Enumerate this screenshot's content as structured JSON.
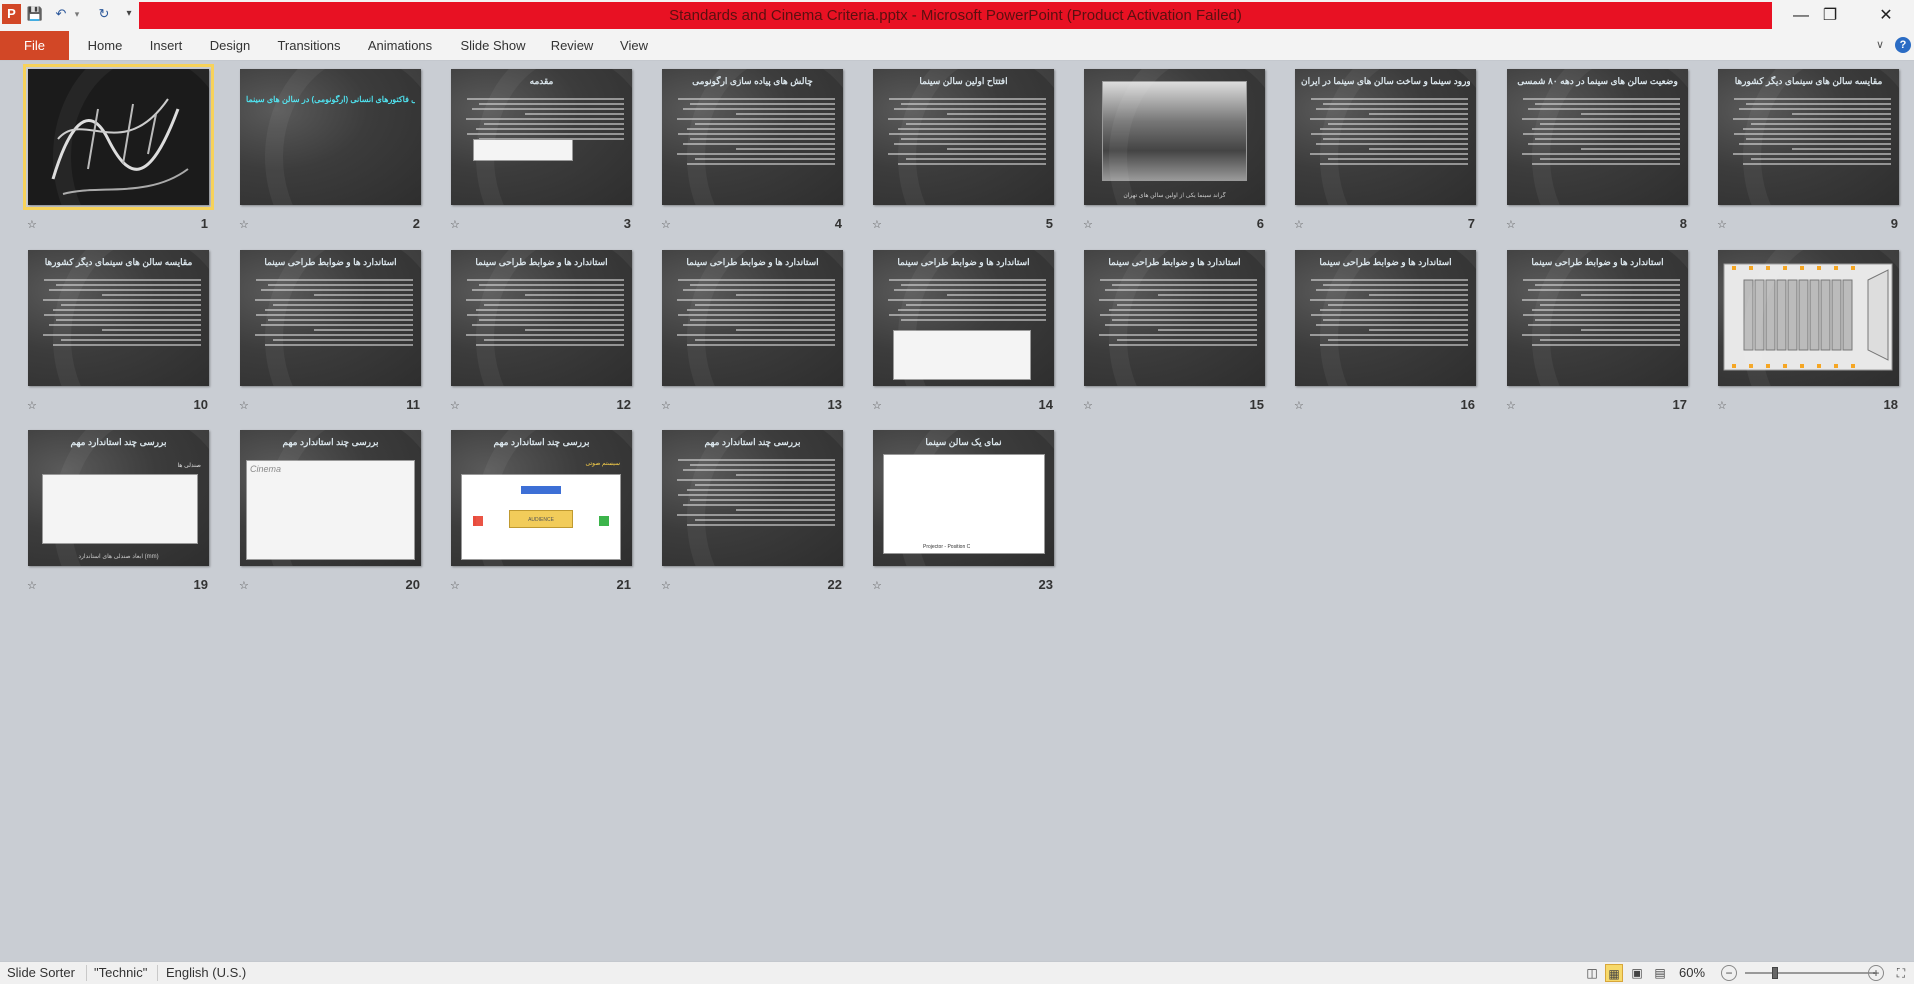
{
  "window": {
    "title": "Standards and Cinema Criteria.pptx  -  Microsoft PowerPoint (Product Activation Failed)",
    "app_icon_letter": "P",
    "quick_access": [
      "save-icon",
      "undo-icon",
      "redo-icon",
      "customize-icon"
    ],
    "controls": {
      "minimize": "—",
      "maximize": "❐",
      "close": "✕"
    }
  },
  "ribbon": {
    "file_tab": "File",
    "tabs": [
      "Home",
      "Insert",
      "Design",
      "Transitions",
      "Animations",
      "Slide Show",
      "Review",
      "View"
    ],
    "collapse_icon": "∨",
    "help_icon": "?"
  },
  "slides": [
    {
      "number": "1",
      "title": "",
      "kind": "calligraphy",
      "selected": true
    },
    {
      "number": "2",
      "title": "مهندسی فاکتورهای انسانی (ارگونومی) در سالن های سینما",
      "kind": "title"
    },
    {
      "number": "3",
      "title": "مقدمه",
      "kind": "text-table"
    },
    {
      "number": "4",
      "title": "چالش های پیاده سازی ارگونومی",
      "kind": "text"
    },
    {
      "number": "5",
      "title": "افتتاح اولین سالن سینما",
      "kind": "text"
    },
    {
      "number": "6",
      "title": "",
      "kind": "photo",
      "caption": "گراند سینما یکی از اولین سالن های تهران"
    },
    {
      "number": "7",
      "title": "ورود سینما و ساخت سالن های سینما در ایران",
      "kind": "text"
    },
    {
      "number": "8",
      "title": "وضعیت سالن های سینما در دهه ۸۰ شمسی",
      "kind": "text"
    },
    {
      "number": "9",
      "title": "مقایسه سالن های سینمای دیگر کشورها",
      "kind": "text"
    },
    {
      "number": "10",
      "title": "مقایسه سالن های سینمای دیگر کشورها",
      "kind": "text"
    },
    {
      "number": "11",
      "title": "استاندارد ها و ضوابط طراحی سینما",
      "kind": "text"
    },
    {
      "number": "12",
      "title": "استاندارد ها و ضوابط طراحی سینما",
      "kind": "text"
    },
    {
      "number": "13",
      "title": "استاندارد ها و ضوابط طراحی سینما",
      "kind": "text"
    },
    {
      "number": "14",
      "title": "استاندارد ها و ضوابط طراحی سینما",
      "kind": "text-drawing"
    },
    {
      "number": "15",
      "title": "استاندارد ها و ضوابط طراحی سینما",
      "kind": "text"
    },
    {
      "number": "16",
      "title": "استاندارد ها و ضوابط طراحی سینما",
      "kind": "text"
    },
    {
      "number": "17",
      "title": "استاندارد ها و ضوابط طراحی سینما",
      "kind": "text"
    },
    {
      "number": "18",
      "title": "",
      "kind": "seating-plan"
    },
    {
      "number": "19",
      "title": "بررسی چند استاندارد مهم",
      "kind": "drawing",
      "caption": "ابعاد صندلی های استاندارد (mm)"
    },
    {
      "number": "20",
      "title": "بررسی چند استاندارد مهم",
      "kind": "drawing-large"
    },
    {
      "number": "21",
      "title": "بررسی چند استاندارد مهم",
      "kind": "audience"
    },
    {
      "number": "22",
      "title": "بررسی چند استاندارد مهم",
      "kind": "text"
    },
    {
      "number": "23",
      "title": "نمای یک سالن سینما",
      "kind": "section-drawing"
    }
  ],
  "slide_subtexts": {
    "s19_heading": "صندلی ها",
    "s20_cinema": "Cinema",
    "s21_heading": "سیستم صوتی",
    "s21_audience": "AUDIENCE",
    "s23_projector": "Projector - Position C"
  },
  "statusbar": {
    "view_name": "Slide Sorter",
    "theme": "\"Technic\"",
    "language": "English (U.S.)",
    "zoom": "60%",
    "zoom_out": "−",
    "zoom_in": "+"
  }
}
